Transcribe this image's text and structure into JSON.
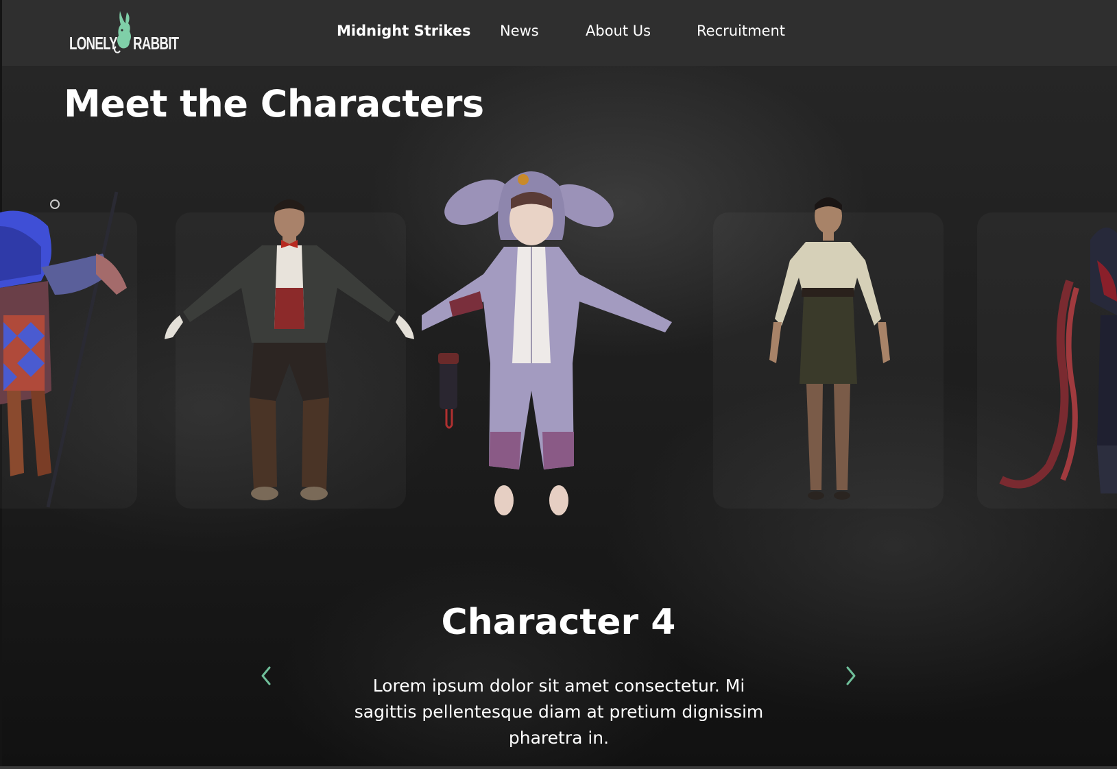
{
  "brand": {
    "logo_left": "LONELY",
    "logo_right": "RABBIT"
  },
  "nav": {
    "items": [
      {
        "label": "Midnight Strikes",
        "active": true
      },
      {
        "label": "News",
        "active": false
      },
      {
        "label": "About Us",
        "active": false
      },
      {
        "label": "Recruitment",
        "active": false
      }
    ]
  },
  "main": {
    "heading": "Meet the Characters",
    "carousel": {
      "current_title": "Character 4",
      "current_description": "Lorem ipsum dolor sit amet consectetur. Mi sagittis pellentesque diam at pretium dignissim pharetra in.",
      "prev_icon": "chevron-left-icon",
      "next_icon": "chevron-right-icon"
    }
  },
  "colors": {
    "nav_bg": "#2f2f2f",
    "accent": "#6fbf9a",
    "text": "#ffffff"
  }
}
